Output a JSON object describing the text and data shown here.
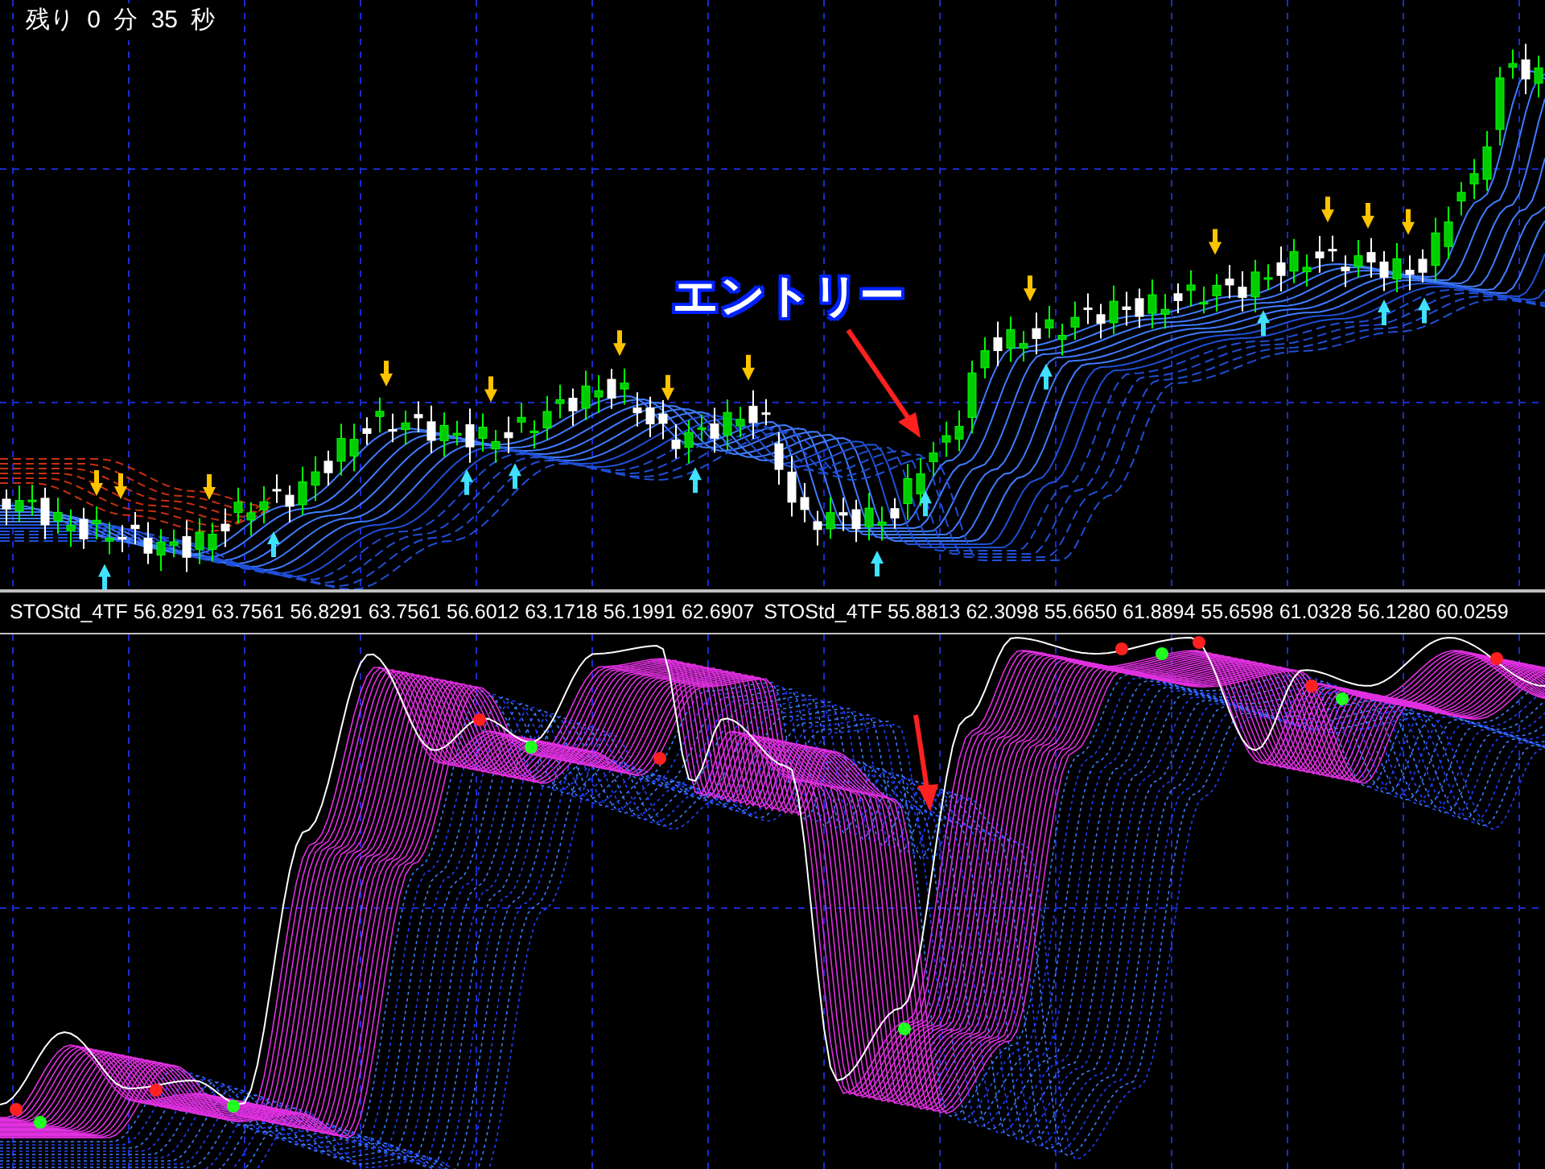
{
  "timer": {
    "label": "残り 0 分 35 秒"
  },
  "annotation": {
    "text": "エントリー"
  },
  "indicator_labels": [
    {
      "text": "STOStd_4TF 56.8291 63.7561 56.8291 63.7561 56.6012 63.1718 56.1991 62.6907"
    },
    {
      "text": "STOStd_4TF 55.8813 62.3098 55.6650 61.8894 55.6598 61.0328 56.1280 60.0259"
    }
  ]
}
